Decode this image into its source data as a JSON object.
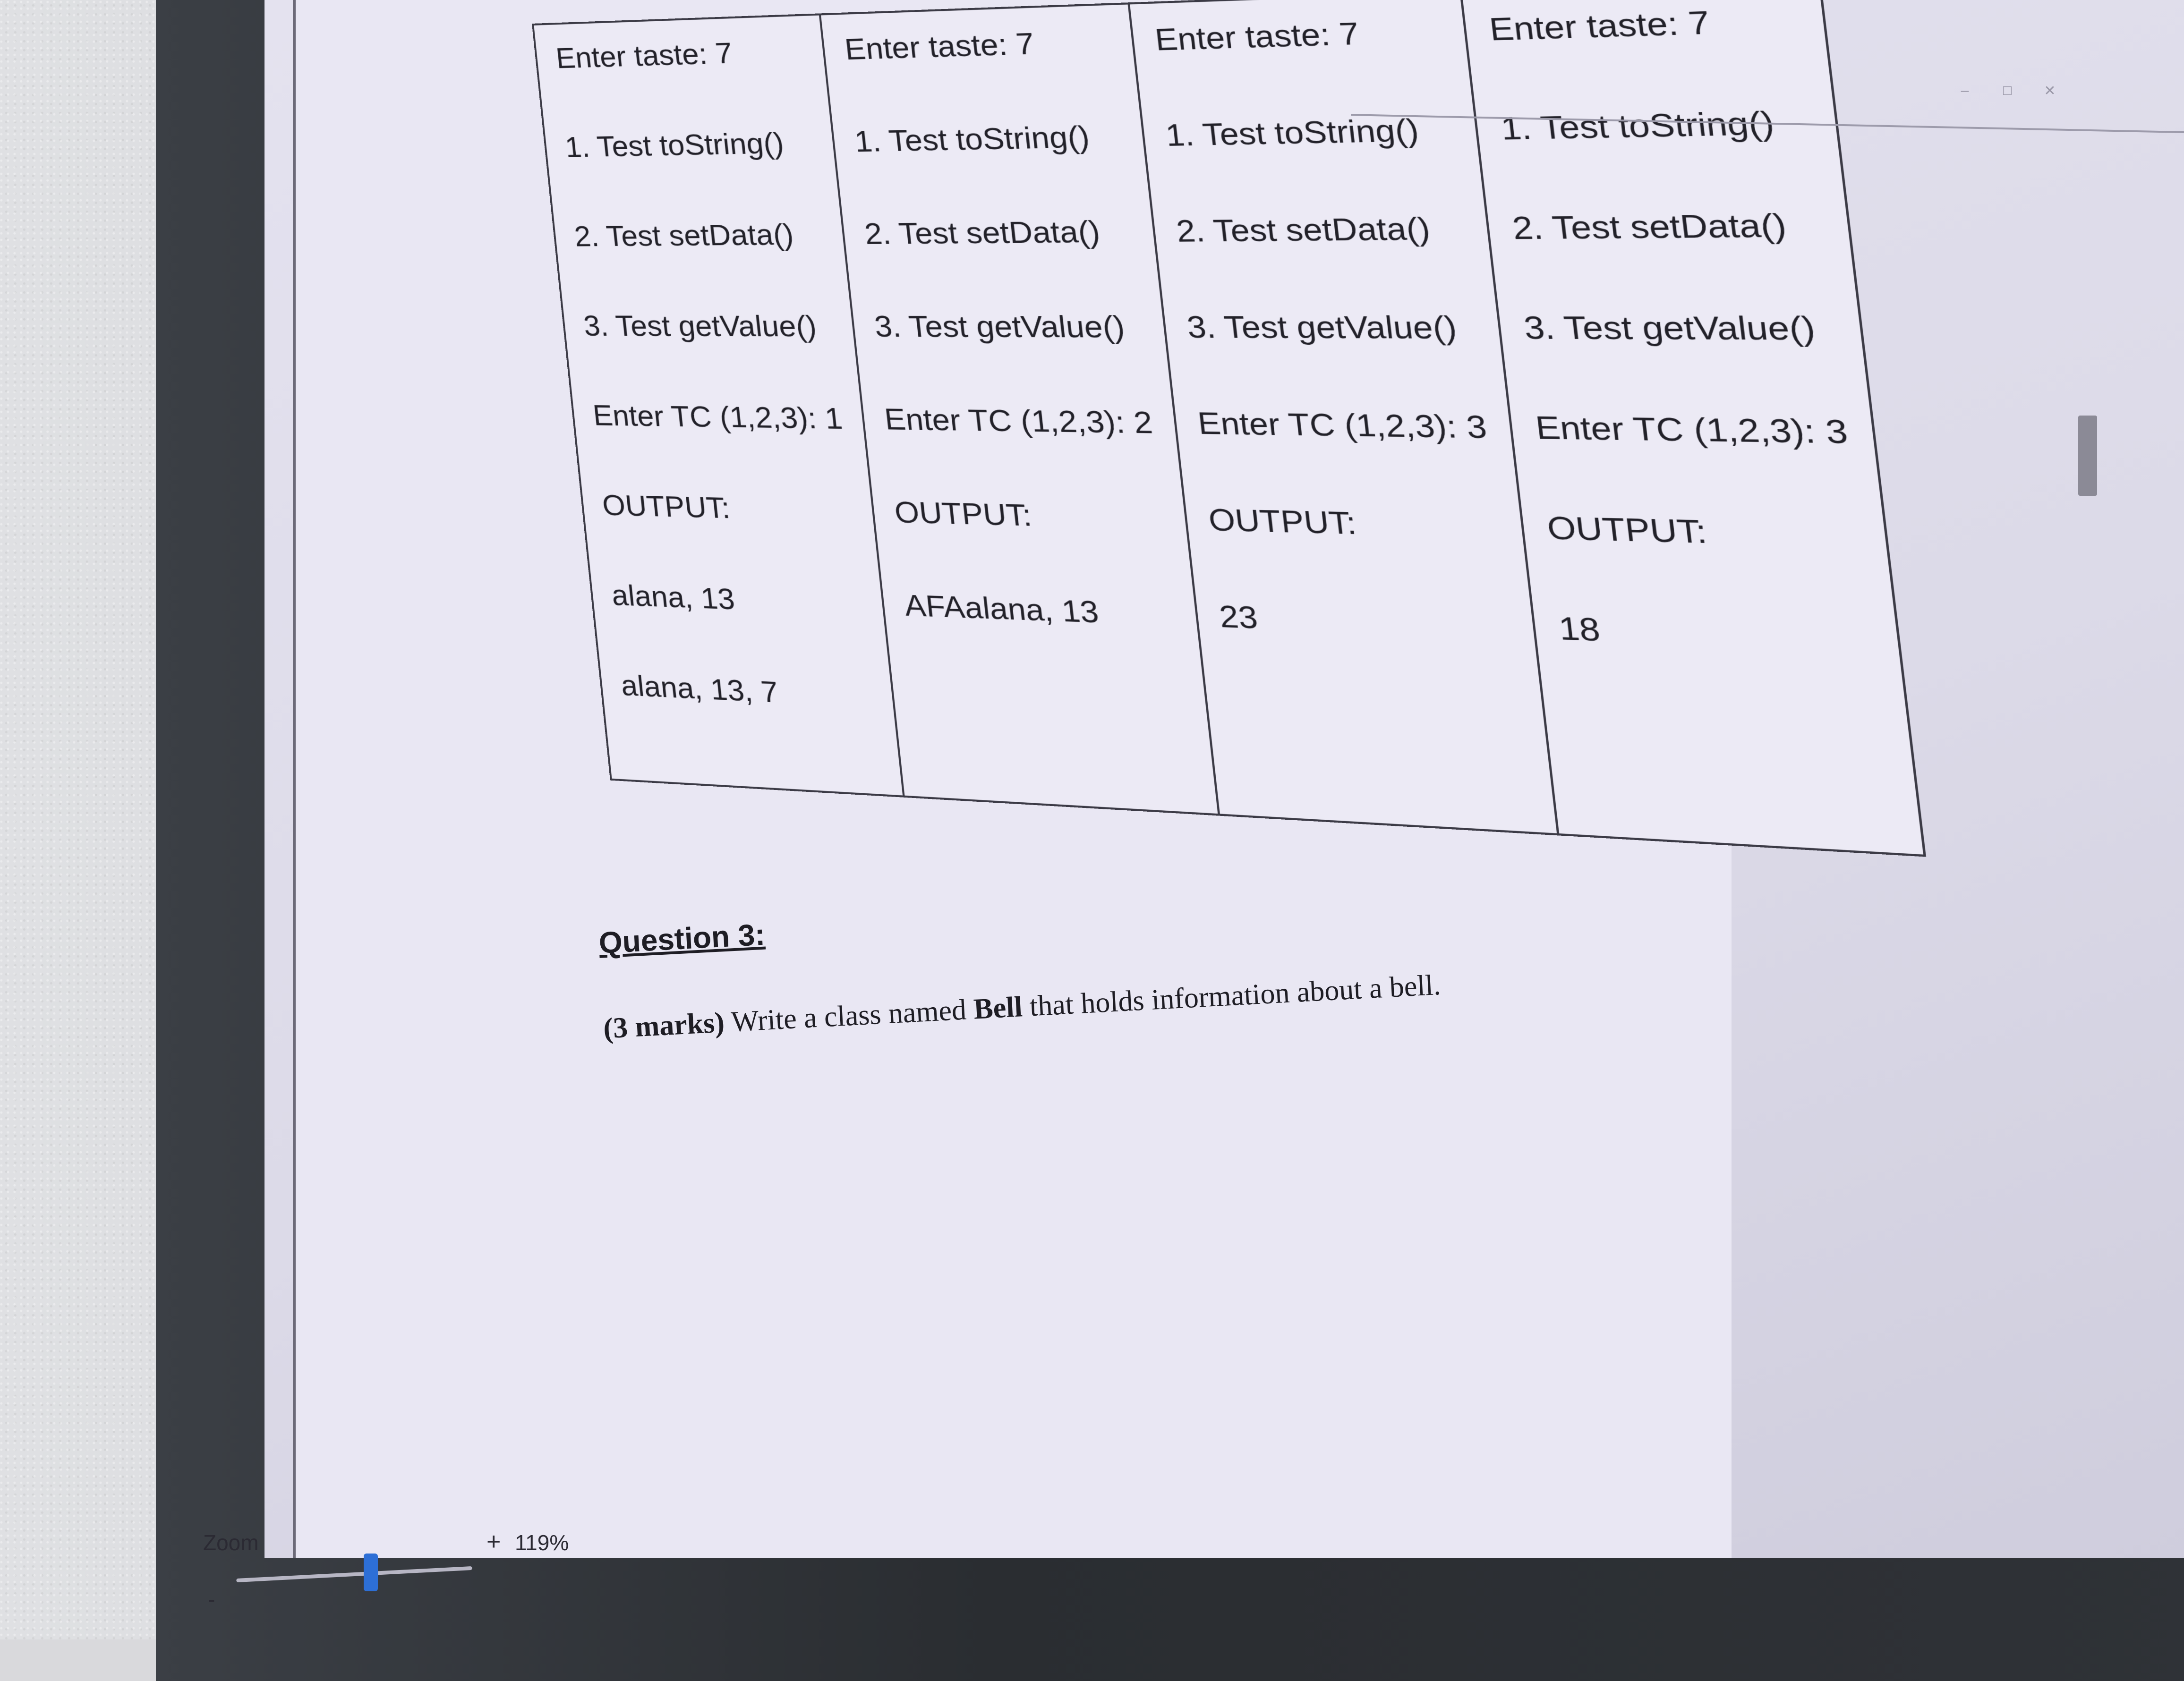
{
  "window": {
    "controls": [
      "–",
      "□",
      "✕"
    ]
  },
  "table": {
    "columns": [
      {
        "lines": [
          "Enter taste: 7",
          "1. Test toString()",
          "2. Test setData()",
          "3. Test getValue()",
          "Enter TC (1,2,3): 1",
          "OUTPUT:",
          "alana, 13",
          "alana, 13, 7"
        ]
      },
      {
        "lines": [
          "Enter taste: 7",
          "1. Test toString()",
          "2. Test setData()",
          "3. Test getValue()",
          "Enter TC (1,2,3): 2",
          "OUTPUT:",
          "AFAalana, 13"
        ]
      },
      {
        "lines": [
          "Enter taste: 7",
          "1. Test toString()",
          "2. Test setData()",
          "3. Test getValue()",
          "Enter TC (1,2,3): 3",
          "OUTPUT:",
          "23"
        ]
      },
      {
        "lines": [
          "Enter taste: 7",
          "1. Test toString()",
          "2. Test setData()",
          "3. Test getValue()",
          "Enter TC (1,2,3): 3",
          "OUTPUT:",
          "18"
        ]
      }
    ]
  },
  "question": {
    "title": "Question 3:",
    "marks": "(3 marks)",
    "text_before": " Write a class named ",
    "class_name": "Bell",
    "text_after": " that holds information about a bell."
  },
  "zoom": {
    "label": "Zoom",
    "minus": "-",
    "plus": "+",
    "value": "119%",
    "level_percent": 119
  },
  "tray": {
    "icons": [
      "chevron-up-icon",
      "battery-icon",
      "wifi-icon",
      "volume-icon",
      "language-icon"
    ]
  },
  "colors": {
    "screen_bg": "#e4e2ef",
    "zoom_thumb": "#2d6fd6",
    "bezel": "#2f3237"
  }
}
